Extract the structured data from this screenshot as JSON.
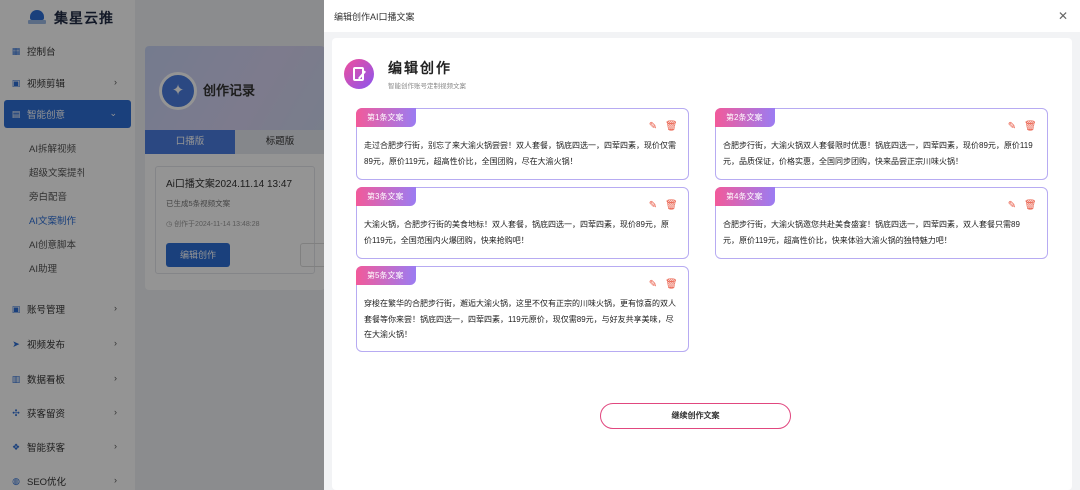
{
  "app": {
    "name": "集星云推"
  },
  "sidebar": {
    "items": [
      {
        "label": "控制台",
        "icon": "grid-icon",
        "has_arrow": false
      },
      {
        "label": "视频剪辑",
        "icon": "video-edit-icon",
        "has_arrow": true
      },
      {
        "label": "智能创意",
        "icon": "creative-icon",
        "has_arrow": true,
        "active": true
      },
      {
        "label": "账号管理",
        "icon": "account-icon",
        "has_arrow": true
      },
      {
        "label": "视频发布",
        "icon": "send-icon",
        "has_arrow": true
      },
      {
        "label": "数据看板",
        "icon": "dashboard-icon",
        "has_arrow": true
      },
      {
        "label": "获客留资",
        "icon": "leads-icon",
        "has_arrow": true
      },
      {
        "label": "智能获客",
        "icon": "acquire-icon",
        "has_arrow": true
      },
      {
        "label": "SEO优化",
        "icon": "seo-icon",
        "has_arrow": true
      }
    ],
    "submenu": [
      "AI拆解视频",
      "超级文案提취",
      "旁白配音",
      "AI文案制作",
      "AI创意脚本",
      "AI助理"
    ]
  },
  "background_page": {
    "hero_title": "创作记录",
    "tabs": [
      "口播版",
      "标题版"
    ],
    "record": {
      "title": "Ai口播文案2024.11.14 13:47",
      "subtitle": "已生成5条视频文案",
      "created": "创作于2024-11-14 13:48:28",
      "edit_button": "编辑创作"
    }
  },
  "drawer": {
    "title": "编辑创作AI口播文案",
    "heading": "编辑创作",
    "subheading": "智能创作账号定制视频文案",
    "cards": [
      {
        "badge": "第1条文案",
        "text": "走过合肥步行街，别忘了来大渝火锅尝尝！双人套餐，锅底四选一，四荤四素，现价仅需89元，原价119元，超高性价比，全国团购，尽在大渝火锅！"
      },
      {
        "badge": "第2条文案",
        "text": "合肥步行街，大渝火锅双人套餐限时优惠！锅底四选一，四荤四素，现价89元，原价119元，品质保证，价格实惠，全国同步团购，快来品尝正宗川味火锅！"
      },
      {
        "badge": "第3条文案",
        "text": "大渝火锅，合肥步行街的美食地标！双人套餐，锅底四选一，四荤四素，现价89元，原价119元，全国范围内火爆团购，快来抢购吧！"
      },
      {
        "badge": "第4条文案",
        "text": "合肥步行街，大渝火锅邀您共赴美食盛宴！锅底四选一，四荤四素，双人套餐只需89元，原价119元，超高性价比，快来体验大渝火锅的独特魅力吧！"
      },
      {
        "badge": "第5条文案",
        "text": "穿梭在繁华的合肥步行街，邂逅大渝火锅，这里不仅有正宗的川味火锅，更有惊喜的双人套餐等你来尝！锅底四选一，四荤四素，119元原价，现仅需89元，与好友共享美味，尽在大渝火锅！"
      }
    ],
    "continue_button": "继续创作文案"
  }
}
